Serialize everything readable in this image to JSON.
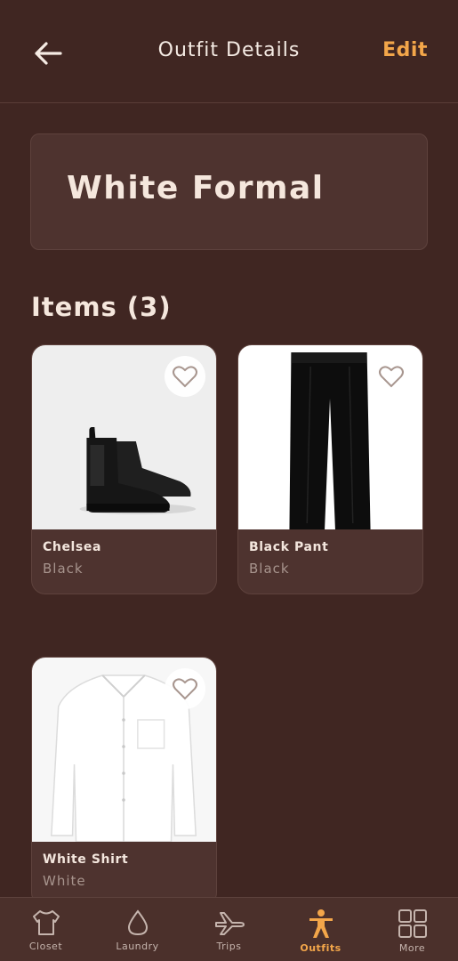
{
  "header": {
    "title": "Outfit Details",
    "edit_label": "Edit"
  },
  "outfit": {
    "name": "White Formal"
  },
  "items_heading": "Items (3)",
  "items": [
    {
      "name": "Chelsea",
      "color": "Black"
    },
    {
      "name": "Black Pant",
      "color": "Black"
    },
    {
      "name": "White Shirt",
      "color": "White"
    }
  ],
  "tabs": [
    {
      "label": "Closet",
      "icon": "shirt-icon"
    },
    {
      "label": "Laundry",
      "icon": "drop-icon"
    },
    {
      "label": "Trips",
      "icon": "plane-icon"
    },
    {
      "label": "Outfits",
      "icon": "person-icon",
      "active": true
    },
    {
      "label": "More",
      "icon": "grid-icon"
    }
  ],
  "colors": {
    "background": "#402622",
    "card": "#4e332f",
    "accent": "#f3a64a"
  }
}
